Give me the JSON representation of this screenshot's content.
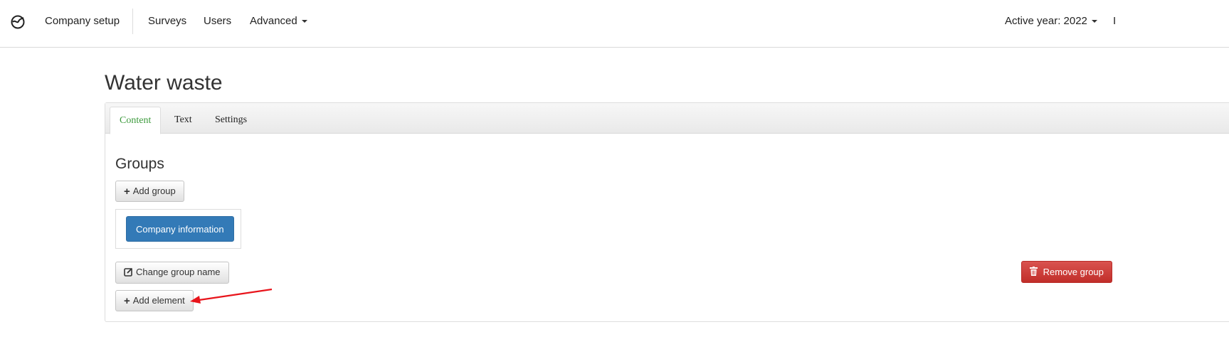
{
  "navbar": {
    "brand": "Company setup",
    "items": [
      {
        "label": "Surveys"
      },
      {
        "label": "Users"
      },
      {
        "label": "Advanced"
      }
    ],
    "active_year": "Active year: 2022",
    "cut_item": "I"
  },
  "page": {
    "title": "Water waste"
  },
  "tabs": [
    {
      "label": "Content",
      "active": true
    },
    {
      "label": "Text",
      "active": false
    },
    {
      "label": "Settings",
      "active": false
    }
  ],
  "groups": {
    "heading": "Groups",
    "add_group": "Add group",
    "group_button": "Company information",
    "change_group_name": "Change group name",
    "remove_group": "Remove group",
    "add_element": "Add element"
  },
  "colors": {
    "primary": "#337ab7",
    "danger": "#d9534f",
    "active_tab": "#3c9a3c",
    "annotation_arrow": "#e8141b"
  },
  "icons": {
    "logo": "logo-icon",
    "plus": "plus-icon",
    "edit": "edit-icon",
    "trash": "trash-icon"
  }
}
